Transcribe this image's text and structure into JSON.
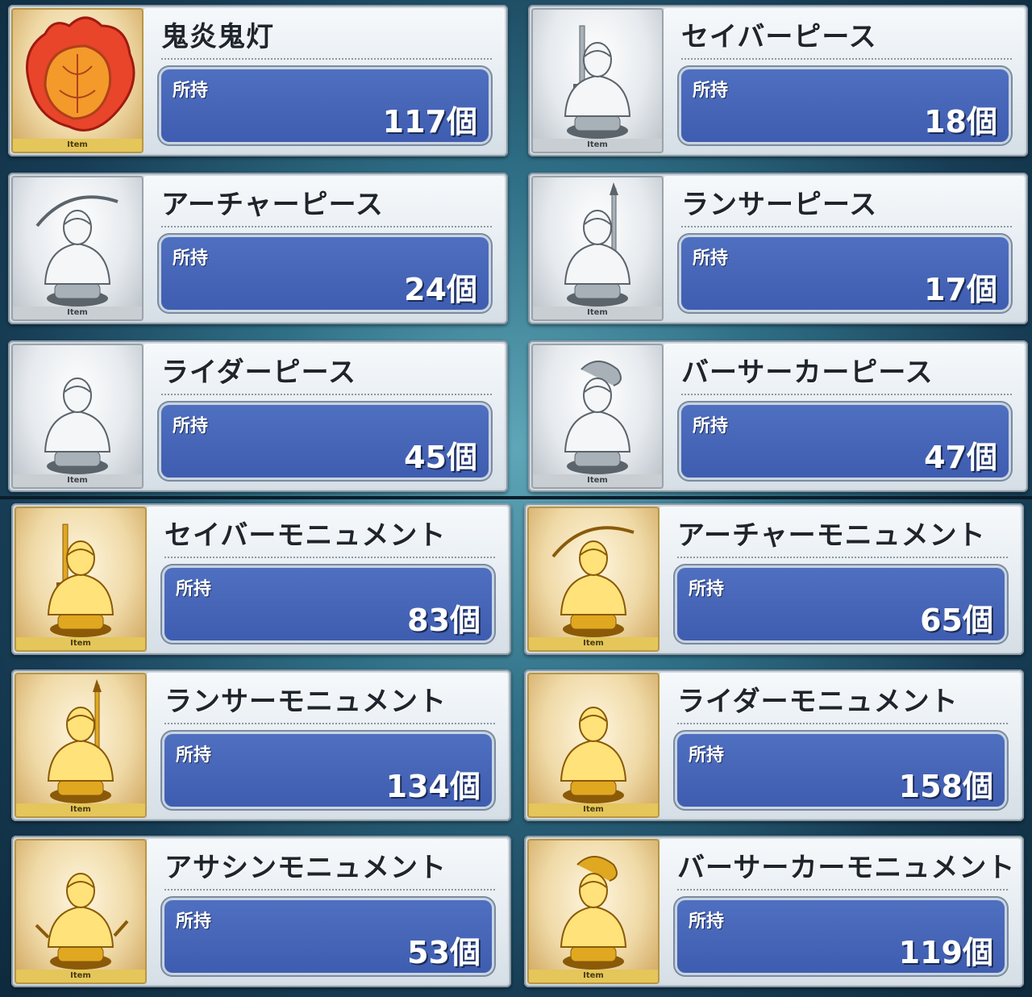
{
  "owned_label": "所持",
  "unit": "個",
  "item_tag": "Item",
  "items": [
    {
      "name": "鬼炎鬼灯",
      "qty": "117個",
      "tier": "special",
      "icon": "flame-lantern-icon"
    },
    {
      "name": "セイバーピース",
      "qty": "18個",
      "tier": "silver",
      "icon": "saber-bust-icon"
    },
    {
      "name": "アーチャーピース",
      "qty": "24個",
      "tier": "silver",
      "icon": "archer-bust-icon"
    },
    {
      "name": "ランサーピース",
      "qty": "17個",
      "tier": "silver",
      "icon": "lancer-bust-icon"
    },
    {
      "name": "ライダーピース",
      "qty": "45個",
      "tier": "silver",
      "icon": "rider-bust-icon"
    },
    {
      "name": "バーサーカーピース",
      "qty": "47個",
      "tier": "silver",
      "icon": "berserker-bust-icon"
    },
    {
      "name": "セイバーモニュメント",
      "qty": "83個",
      "tier": "gold",
      "icon": "saber-bust-icon"
    },
    {
      "name": "アーチャーモニュメント",
      "qty": "65個",
      "tier": "gold",
      "icon": "archer-bust-icon"
    },
    {
      "name": "ランサーモニュメント",
      "qty": "134個",
      "tier": "gold",
      "icon": "lancer-bust-icon"
    },
    {
      "name": "ライダーモニュメント",
      "qty": "158個",
      "tier": "gold",
      "icon": "rider-bust-icon"
    },
    {
      "name": "アサシンモニュメント",
      "qty": "53個",
      "tier": "gold",
      "icon": "assassin-bust-icon"
    },
    {
      "name": "バーサーカーモニュメント",
      "qty": "119個",
      "tier": "gold",
      "icon": "berserker-bust-icon"
    }
  ]
}
